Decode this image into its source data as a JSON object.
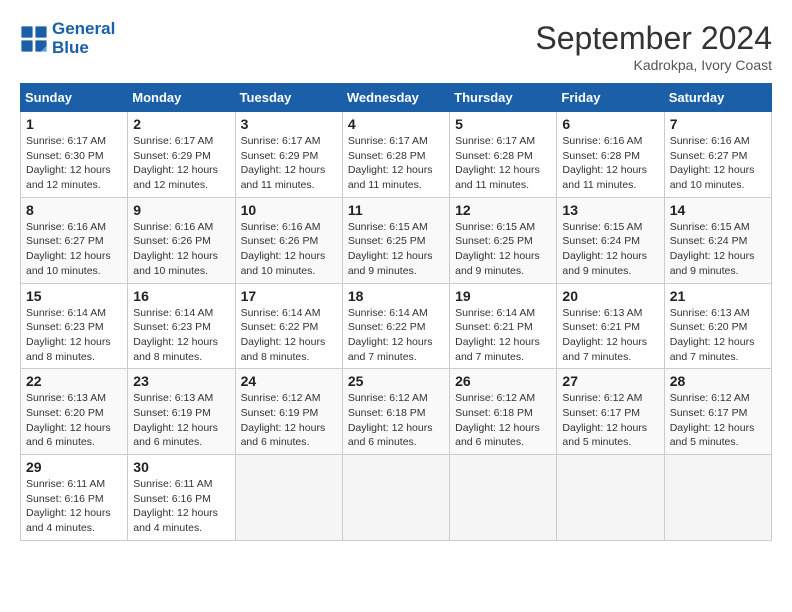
{
  "header": {
    "logo_line1": "General",
    "logo_line2": "Blue",
    "title": "September 2024",
    "subtitle": "Kadrokpa, Ivory Coast"
  },
  "calendar": {
    "days_of_week": [
      "Sunday",
      "Monday",
      "Tuesday",
      "Wednesday",
      "Thursday",
      "Friday",
      "Saturday"
    ],
    "weeks": [
      [
        {
          "day": "1",
          "sunrise": "6:17 AM",
          "sunset": "6:30 PM",
          "daylight": "12 hours and 12 minutes."
        },
        {
          "day": "2",
          "sunrise": "6:17 AM",
          "sunset": "6:29 PM",
          "daylight": "12 hours and 12 minutes."
        },
        {
          "day": "3",
          "sunrise": "6:17 AM",
          "sunset": "6:29 PM",
          "daylight": "12 hours and 11 minutes."
        },
        {
          "day": "4",
          "sunrise": "6:17 AM",
          "sunset": "6:28 PM",
          "daylight": "12 hours and 11 minutes."
        },
        {
          "day": "5",
          "sunrise": "6:17 AM",
          "sunset": "6:28 PM",
          "daylight": "12 hours and 11 minutes."
        },
        {
          "day": "6",
          "sunrise": "6:16 AM",
          "sunset": "6:28 PM",
          "daylight": "12 hours and 11 minutes."
        },
        {
          "day": "7",
          "sunrise": "6:16 AM",
          "sunset": "6:27 PM",
          "daylight": "12 hours and 10 minutes."
        }
      ],
      [
        {
          "day": "8",
          "sunrise": "6:16 AM",
          "sunset": "6:27 PM",
          "daylight": "12 hours and 10 minutes."
        },
        {
          "day": "9",
          "sunrise": "6:16 AM",
          "sunset": "6:26 PM",
          "daylight": "12 hours and 10 minutes."
        },
        {
          "day": "10",
          "sunrise": "6:16 AM",
          "sunset": "6:26 PM",
          "daylight": "12 hours and 10 minutes."
        },
        {
          "day": "11",
          "sunrise": "6:15 AM",
          "sunset": "6:25 PM",
          "daylight": "12 hours and 9 minutes."
        },
        {
          "day": "12",
          "sunrise": "6:15 AM",
          "sunset": "6:25 PM",
          "daylight": "12 hours and 9 minutes."
        },
        {
          "day": "13",
          "sunrise": "6:15 AM",
          "sunset": "6:24 PM",
          "daylight": "12 hours and 9 minutes."
        },
        {
          "day": "14",
          "sunrise": "6:15 AM",
          "sunset": "6:24 PM",
          "daylight": "12 hours and 9 minutes."
        }
      ],
      [
        {
          "day": "15",
          "sunrise": "6:14 AM",
          "sunset": "6:23 PM",
          "daylight": "12 hours and 8 minutes."
        },
        {
          "day": "16",
          "sunrise": "6:14 AM",
          "sunset": "6:23 PM",
          "daylight": "12 hours and 8 minutes."
        },
        {
          "day": "17",
          "sunrise": "6:14 AM",
          "sunset": "6:22 PM",
          "daylight": "12 hours and 8 minutes."
        },
        {
          "day": "18",
          "sunrise": "6:14 AM",
          "sunset": "6:22 PM",
          "daylight": "12 hours and 7 minutes."
        },
        {
          "day": "19",
          "sunrise": "6:14 AM",
          "sunset": "6:21 PM",
          "daylight": "12 hours and 7 minutes."
        },
        {
          "day": "20",
          "sunrise": "6:13 AM",
          "sunset": "6:21 PM",
          "daylight": "12 hours and 7 minutes."
        },
        {
          "day": "21",
          "sunrise": "6:13 AM",
          "sunset": "6:20 PM",
          "daylight": "12 hours and 7 minutes."
        }
      ],
      [
        {
          "day": "22",
          "sunrise": "6:13 AM",
          "sunset": "6:20 PM",
          "daylight": "12 hours and 6 minutes."
        },
        {
          "day": "23",
          "sunrise": "6:13 AM",
          "sunset": "6:19 PM",
          "daylight": "12 hours and 6 minutes."
        },
        {
          "day": "24",
          "sunrise": "6:12 AM",
          "sunset": "6:19 PM",
          "daylight": "12 hours and 6 minutes."
        },
        {
          "day": "25",
          "sunrise": "6:12 AM",
          "sunset": "6:18 PM",
          "daylight": "12 hours and 6 minutes."
        },
        {
          "day": "26",
          "sunrise": "6:12 AM",
          "sunset": "6:18 PM",
          "daylight": "12 hours and 6 minutes."
        },
        {
          "day": "27",
          "sunrise": "6:12 AM",
          "sunset": "6:17 PM",
          "daylight": "12 hours and 5 minutes."
        },
        {
          "day": "28",
          "sunrise": "6:12 AM",
          "sunset": "6:17 PM",
          "daylight": "12 hours and 5 minutes."
        }
      ],
      [
        {
          "day": "29",
          "sunrise": "6:11 AM",
          "sunset": "6:16 PM",
          "daylight": "12 hours and 4 minutes."
        },
        {
          "day": "30",
          "sunrise": "6:11 AM",
          "sunset": "6:16 PM",
          "daylight": "12 hours and 4 minutes."
        },
        null,
        null,
        null,
        null,
        null
      ]
    ]
  }
}
